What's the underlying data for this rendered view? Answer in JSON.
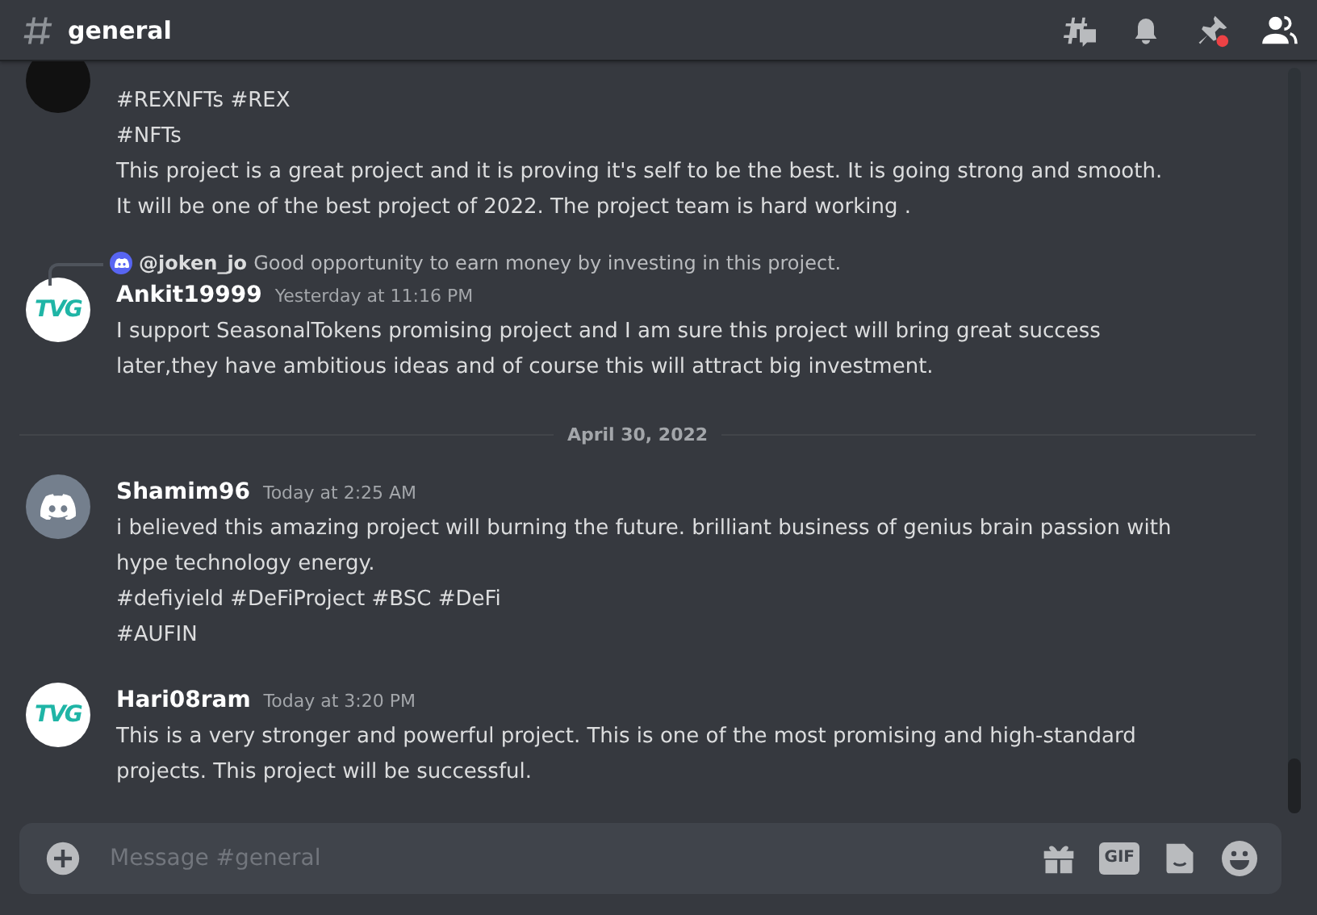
{
  "channel": {
    "name": "general"
  },
  "messages": [
    {
      "kind": "continued",
      "avatar": {
        "kind": "photo"
      },
      "lines": [
        "#REXNFTs #REX",
        "#NFTs",
        "This project is a great project and it is proving it's self to be the best. It is going strong and smooth.",
        "It will be one of the best project of 2022. The project team is hard working ."
      ]
    },
    {
      "kind": "message",
      "avatar": {
        "kind": "tvg",
        "text": "TVG"
      },
      "reply": {
        "author": "@joken_jo",
        "text": "Good opportunity to earn money by investing in this project."
      },
      "author": "Ankit19999",
      "time": "Yesterday at 11:16 PM",
      "lines": [
        "I support SeasonalTokens  promising project and I am sure this project will bring great success",
        "later,they have ambitious ideas and of course this will attract big investment."
      ]
    },
    {
      "kind": "divider",
      "label": "April 30, 2022"
    },
    {
      "kind": "message",
      "avatar": {
        "kind": "discord"
      },
      "author": "Shamim96",
      "time": "Today at 2:25 AM",
      "lines": [
        "i believed this amazing project will burning the future. brilliant business of genius brain passion with",
        "hype technology energy.",
        "#defiyield #DeFiProject #BSC #DeFi",
        "#AUFIN"
      ]
    },
    {
      "kind": "message",
      "avatar": {
        "kind": "tvg",
        "text": "TVG"
      },
      "author": "Hari08ram",
      "time": "Today at 3:20 PM",
      "lines": [
        "This is a very stronger and powerful project. This is one of the most promising and high-standard",
        "projects. This project will be successful."
      ]
    }
  ],
  "composer": {
    "placeholder": "Message #general",
    "gif_label": "GIF"
  }
}
